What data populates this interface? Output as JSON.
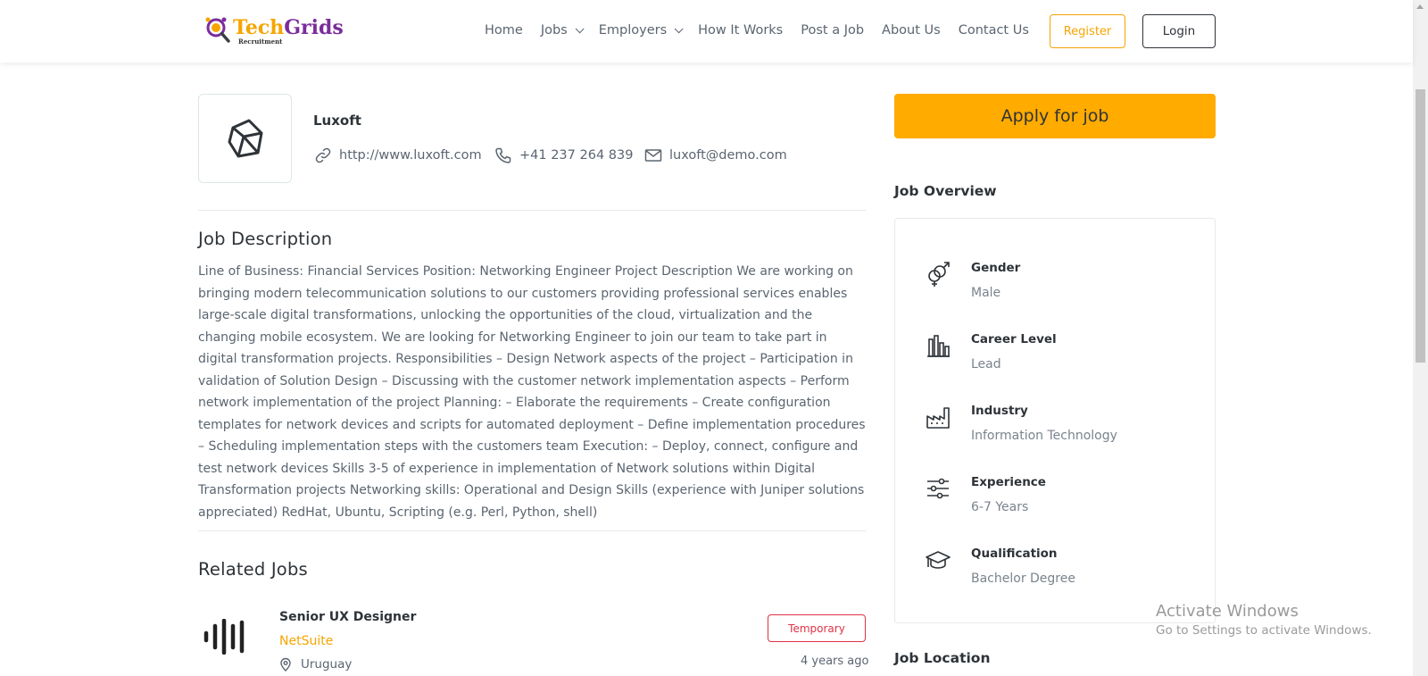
{
  "header": {
    "logo": {
      "brand_part1": "Tech",
      "brand_part2": "Grids",
      "tagline": "Recruitment"
    },
    "nav": [
      {
        "label": "Home",
        "has_dropdown": false
      },
      {
        "label": "Jobs",
        "has_dropdown": true
      },
      {
        "label": "Employers",
        "has_dropdown": true
      },
      {
        "label": "How It Works",
        "has_dropdown": false
      },
      {
        "label": "Post a Job",
        "has_dropdown": false
      },
      {
        "label": "About Us",
        "has_dropdown": false
      },
      {
        "label": "Contact Us",
        "has_dropdown": false
      }
    ],
    "register_label": "Register",
    "login_label": "Login"
  },
  "company": {
    "name": "Luxoft",
    "website": "http://www.luxoft.com",
    "phone": "+41 237 264 839",
    "email": "luxoft@demo.com",
    "logo_icon": "polyhedron-icon"
  },
  "job_description": {
    "title": "Job Description",
    "text": "Line of Business: Financial Services Position: Networking Engineer Project Description We are working on bringing modern telecommunication solutions to our customers providing professional services enables large-scale digital transformations, unlocking the opportunities of the cloud, virtualization and the changing mobile ecosystem. We are looking for Networking Engineer to join our team to take part in digital transformation projects. Responsibilities – Design Network aspects of the project – Participation in validation of Solution Design – Discussing with the customer network implementation aspects – Perform network implementation of the project Planning: – Elaborate the requirements – Create configuration templates for network devices and scripts for automated deployment – Define implementation procedures – Scheduling implementation steps with the customers team Execution: – Deploy, connect, configure and test network devices Skills 3-5 of experience in implementation of Network solutions within Digital Transformation projects Networking skills: Operational and Design Skills (experience with Juniper solutions appreciated) RedHat, Ubuntu, Scripting (e.g. Perl, Python, shell)"
  },
  "related_jobs": {
    "title": "Related Jobs",
    "items": [
      {
        "title": "Senior UX Designer",
        "company": "NetSuite",
        "location": "Uruguay",
        "type": "Temporary",
        "posted": "4 years ago"
      }
    ]
  },
  "sidebar": {
    "apply_label": "Apply for job",
    "overview_title": "Job Overview",
    "overview": [
      {
        "label": "Gender",
        "value": "Male",
        "icon": "gender-icon"
      },
      {
        "label": "Career Level",
        "value": "Lead",
        "icon": "bar-chart-icon"
      },
      {
        "label": "Industry",
        "value": "Information Technology",
        "icon": "factory-icon"
      },
      {
        "label": "Experience",
        "value": "6-7 Years",
        "icon": "sliders-icon"
      },
      {
        "label": "Qualification",
        "value": "Bachelor Degree",
        "icon": "graduation-cap-icon"
      }
    ],
    "location_title": "Job Location"
  },
  "watermark": {
    "title": "Activate Windows",
    "subtitle": "Go to Settings to activate Windows."
  },
  "colors": {
    "accent": "#ffab00",
    "brand_purple": "#7b2d9b",
    "badge_red": "#e03246",
    "text_dark": "#2e3338",
    "text_muted": "#5b6570"
  }
}
